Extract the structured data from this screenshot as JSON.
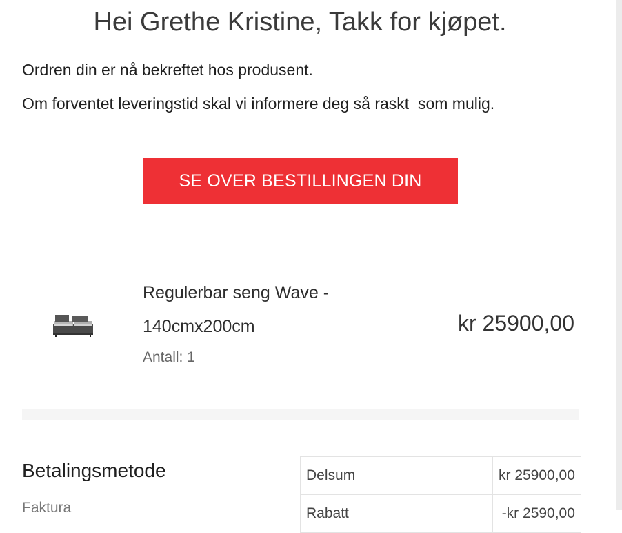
{
  "greeting": {
    "title": "Hei Grethe Kristine, Takk for kjøpet.",
    "line1": "Ordren din er nå bekreftet hos produsent.",
    "line2": "Om forventet leveringstid skal vi informere deg så raskt  som mulig."
  },
  "cta": {
    "label": "SE OVER BESTILLINGEN DIN",
    "color": "#ee3035"
  },
  "product": {
    "image_icon": "adjustable-bed-image",
    "name": "Regulerbar seng Wave - 140cmx200cm",
    "qty_label": "Antall: 1",
    "price": "kr 25900,00"
  },
  "payment": {
    "heading": "Betalingsmetode",
    "method": "Faktura"
  },
  "totals": [
    {
      "label": "Delsum",
      "value": "kr 25900,00"
    },
    {
      "label": "Rabatt",
      "value": "-kr 2590,00"
    }
  ]
}
